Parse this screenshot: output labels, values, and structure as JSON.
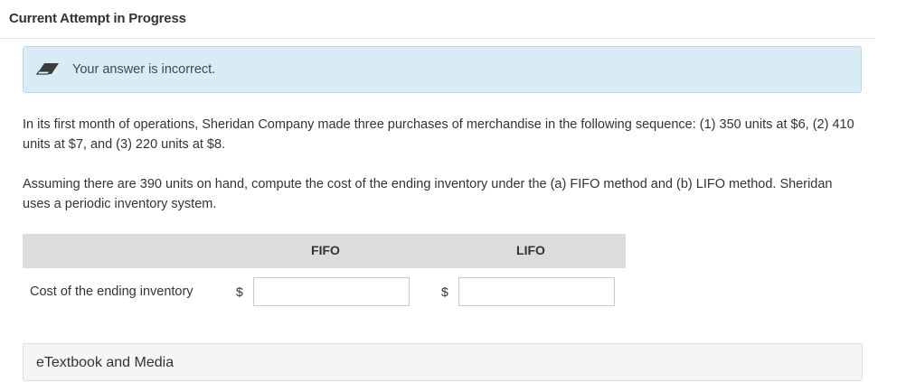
{
  "header": {
    "title": "Current Attempt in Progress"
  },
  "feedback": {
    "icon": "eraser-icon",
    "message": "Your answer is incorrect.",
    "background_color": "#d9ecf5"
  },
  "question": {
    "paragraph_1": "In its first month of operations, Sheridan Company made three purchases of merchandise in the following sequence: (1) 350 units at $6, (2) 410 units at $7, and (3) 220 units at $8.",
    "paragraph_2": "Assuming there are 390 units on hand, compute the cost of the ending inventory under the (a) FIFO method and (b) LIFO method. Sheridan uses a periodic inventory system."
  },
  "answer_grid": {
    "columns": [
      "FIFO",
      "LIFO"
    ],
    "row_label": "Cost of the ending inventory",
    "currency_symbol": "$",
    "fifo_value": "",
    "lifo_value": ""
  },
  "resources": {
    "etextbook_label": "eTextbook and Media"
  }
}
